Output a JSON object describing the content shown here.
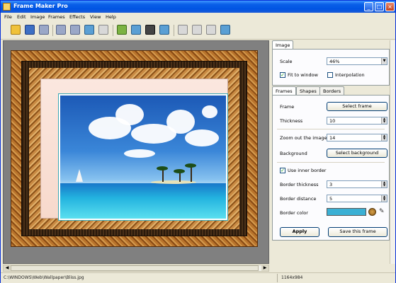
{
  "window": {
    "title": "Frame Maker Pro"
  },
  "menu": [
    "File",
    "Edit",
    "Image",
    "Frames",
    "Effects",
    "View",
    "Help"
  ],
  "image_tab": {
    "tab_label": "Image",
    "scale_label": "Scale",
    "scale_value": "46%",
    "fit_to_window": "Fit to window",
    "interpolation": "Interpolation"
  },
  "frames_tabs": [
    "Frames",
    "Shapes",
    "Borders"
  ],
  "frames": {
    "frame_label": "Frame",
    "select_frame": "Select frame",
    "thickness_label": "Thickness",
    "thickness_value": "10",
    "zoom_label": "Zoom out the image",
    "zoom_value": "14",
    "background_label": "Background",
    "select_background": "Select background",
    "use_inner_border": "Use inner border",
    "border_thickness_label": "Border thickness",
    "border_thickness_value": "3",
    "border_distance_label": "Border distance",
    "border_distance_value": "5",
    "border_color_label": "Border color",
    "border_color": "#3bb0d4"
  },
  "buttons": {
    "apply": "Apply",
    "save_frame": "Save this frame"
  },
  "status": {
    "path": "C:\\WINDOWS\\Web\\Wallpaper\\Bliss.jpg",
    "size": "1164x984"
  }
}
